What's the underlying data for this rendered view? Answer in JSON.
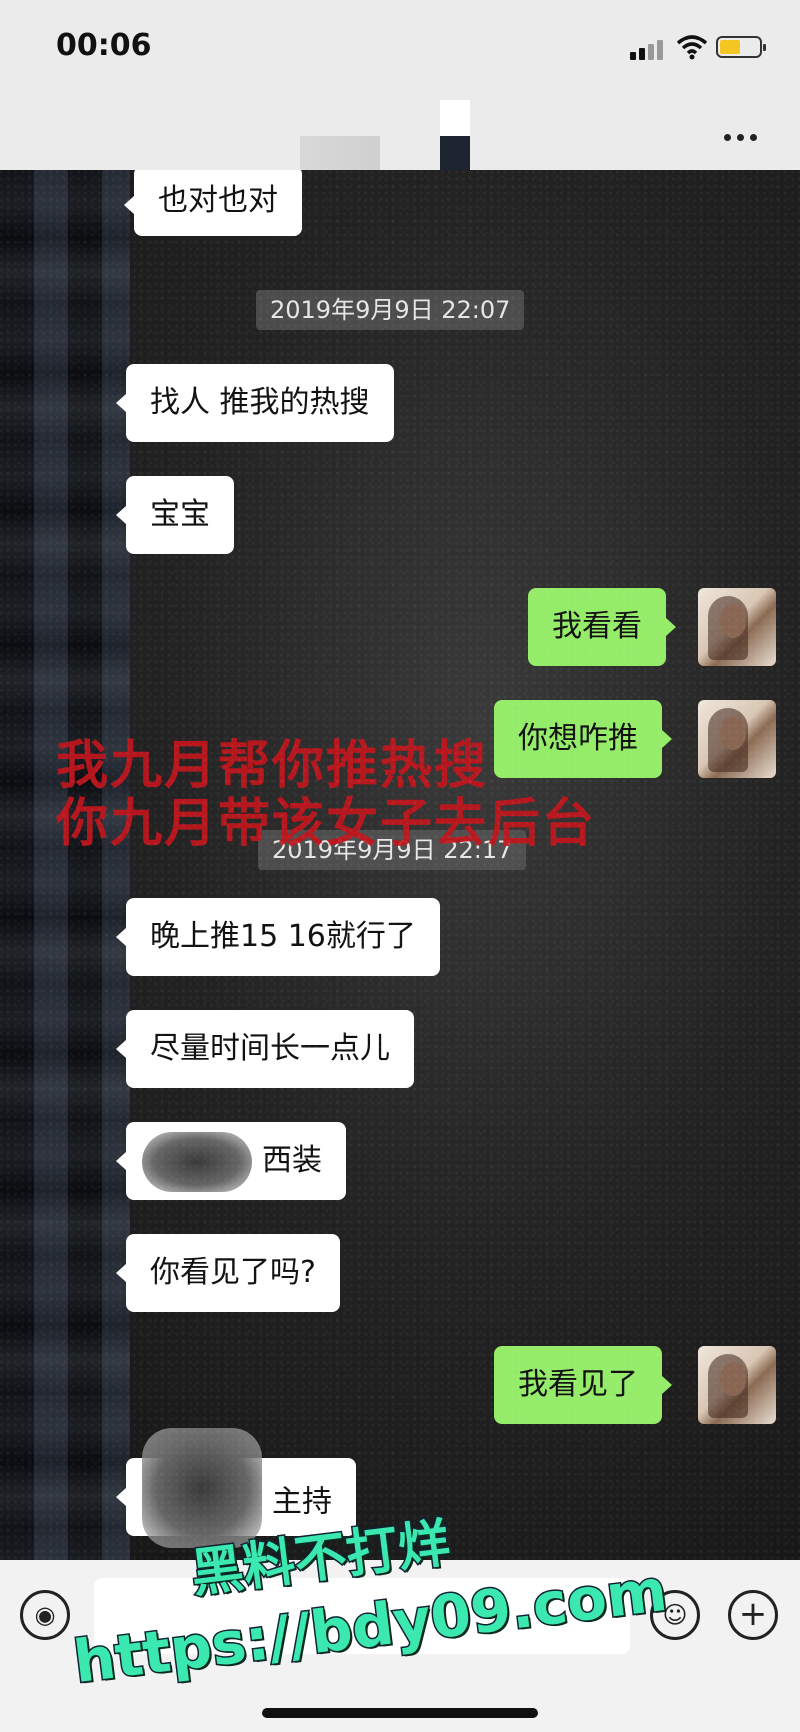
{
  "status_bar": {
    "time": "00:06"
  },
  "header": {
    "more_label": "..."
  },
  "messages": [
    {
      "side": "left",
      "text": "也对也对"
    },
    {
      "type": "timestamp",
      "text": "2019年9月9日 22:07"
    },
    {
      "side": "left",
      "text": "找人  推我的热搜"
    },
    {
      "side": "left",
      "text": "宝宝"
    },
    {
      "side": "right",
      "text": "我看看"
    },
    {
      "side": "right",
      "text": "你想咋推"
    },
    {
      "type": "timestamp",
      "text": "2019年9月9日 22:17"
    },
    {
      "side": "left",
      "text": "晚上推15   16就行了"
    },
    {
      "side": "left",
      "text": "尽量时间长一点儿"
    },
    {
      "side": "left",
      "text": "西装"
    },
    {
      "side": "left",
      "text": "你看见了吗?"
    },
    {
      "side": "right",
      "text": "我看见了"
    },
    {
      "side": "left",
      "text": "主持"
    }
  ],
  "overlay": {
    "line1": "我九月帮你推热搜",
    "line2": "你九月带该女子去后台"
  },
  "watermark": {
    "line1": "黑料不打烊",
    "line2": "https://bdy09.com"
  },
  "colors": {
    "bubble_left": "#ffffff",
    "bubble_right": "#95ec69",
    "overlay_red": "#c2161d",
    "watermark_green": "#3be8b0"
  }
}
